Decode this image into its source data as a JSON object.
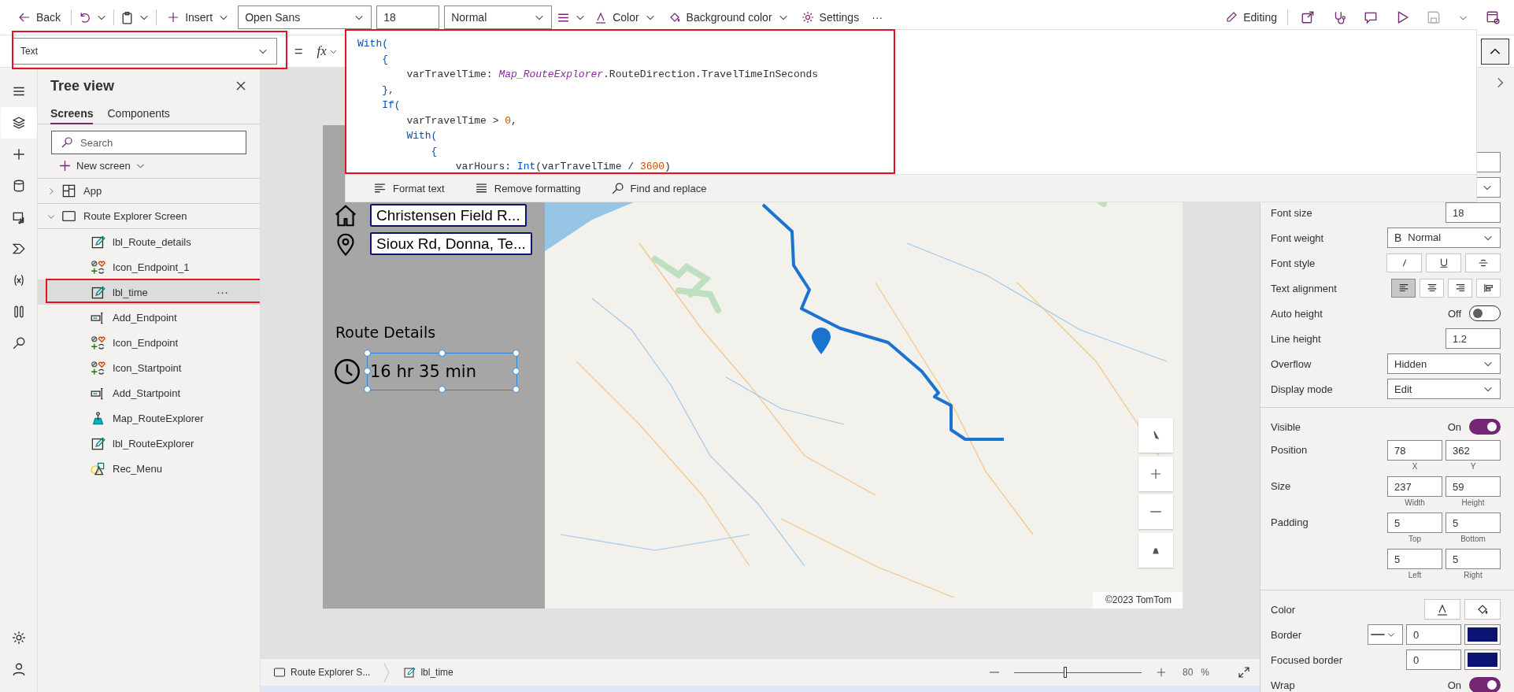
{
  "toolbar": {
    "back": "Back",
    "insert": "Insert",
    "font": "Open Sans",
    "font_size": "18",
    "font_weight": "Normal",
    "text_color_label": "Color",
    "background_color_label": "Background color",
    "settings_label": "Settings",
    "more": "···",
    "mode": "Editing"
  },
  "formula_bar": {
    "property": "Text",
    "equals": "=",
    "fx": "fx",
    "code": [
      [
        {
          "kind": "keyword",
          "text": "With("
        }
      ],
      [
        {
          "kind": "punct",
          "text": "    {"
        }
      ],
      [
        {
          "kind": "plain",
          "text": "        varTravelTime: "
        },
        {
          "kind": "ref",
          "text": "Map_RouteExplorer"
        },
        {
          "kind": "plain",
          "text": ".RouteDirection.TravelTimeInSeconds"
        }
      ],
      [
        {
          "kind": "punct",
          "text": "    },"
        }
      ],
      [
        {
          "kind": "keyword",
          "text": "    If("
        }
      ],
      [
        {
          "kind": "plain",
          "text": "        varTravelTime > "
        },
        {
          "kind": "number",
          "text": "0"
        },
        {
          "kind": "plain",
          "text": ","
        }
      ],
      [
        {
          "kind": "keyword",
          "text": "        With("
        }
      ],
      [
        {
          "kind": "punct",
          "text": "            {"
        }
      ],
      [
        {
          "kind": "plain",
          "text": "                varHours: "
        },
        {
          "kind": "keyword",
          "text": "Int"
        },
        {
          "kind": "plain",
          "text": "(varTravelTime / "
        },
        {
          "kind": "number",
          "text": "3600"
        },
        {
          "kind": "plain",
          "text": ")"
        }
      ]
    ],
    "tools": [
      {
        "kind": "format",
        "label": "Format text"
      },
      {
        "kind": "remove",
        "label": "Remove formatting"
      },
      {
        "kind": "find",
        "label": "Find and replace"
      }
    ]
  },
  "tree": {
    "title": "Tree view",
    "tabs": [
      {
        "label": "Screens",
        "selected": true
      },
      {
        "label": "Components",
        "selected": false
      }
    ],
    "search_placeholder": "Search",
    "new_screen": "New screen",
    "more": "···",
    "items": [
      {
        "label": "App",
        "kind": "app",
        "expanded": false,
        "selected": false
      },
      {
        "label": "Route Explorer Screen",
        "kind": "screen",
        "expanded": true,
        "selected": false,
        "children": [
          {
            "label": "lbl_Route_details",
            "kind": "label",
            "selected": false
          },
          {
            "label": "Icon_Endpoint_1",
            "kind": "icon",
            "selected": false
          },
          {
            "label": "lbl_time",
            "kind": "label",
            "selected": true
          },
          {
            "label": "Add_Endpoint",
            "kind": "input",
            "selected": false
          },
          {
            "label": "Icon_Endpoint",
            "kind": "icon",
            "selected": false
          },
          {
            "label": "Icon_Startpoint",
            "kind": "icon",
            "selected": false
          },
          {
            "label": "Add_Startpoint",
            "kind": "input",
            "selected": false
          },
          {
            "label": "Map_RouteExplorer",
            "kind": "map",
            "selected": false
          },
          {
            "label": "lbl_RouteExplorer",
            "kind": "label",
            "selected": false
          },
          {
            "label": "Rec_Menu",
            "kind": "shape",
            "selected": false
          }
        ]
      }
    ]
  },
  "canvas": {
    "start_address": "Christensen Field R...",
    "end_address": "Sioux Rd, Donna, Te...",
    "route_heading": "Route Details",
    "travel_time": "16 hr 35 min",
    "map_attribution": "©2023 TomTom"
  },
  "properties": [
    {
      "kind": "blank_field"
    },
    {
      "kind": "blank_dropdown"
    },
    {
      "kind": "field",
      "label": "Font size",
      "value": "18"
    },
    {
      "kind": "dropdown",
      "label": "Font weight",
      "prefix": "B",
      "value": "Normal"
    },
    {
      "kind": "style_buttons",
      "label": "Font style",
      "buttons": [
        {
          "kind": "italic"
        },
        {
          "kind": "underline"
        },
        {
          "kind": "strike"
        }
      ]
    },
    {
      "kind": "align_buttons",
      "label": "Text alignment",
      "buttons": [
        {
          "kind": "left",
          "selected": true
        },
        {
          "kind": "center",
          "selected": false
        },
        {
          "kind": "right",
          "selected": false
        },
        {
          "kind": "top",
          "selected": false
        }
      ]
    },
    {
      "kind": "toggle",
      "label": "Auto height",
      "value": "Off",
      "on": false
    },
    {
      "kind": "field",
      "label": "Line height",
      "value": "1.2"
    },
    {
      "kind": "dropdown",
      "label": "Overflow",
      "value": "Hidden"
    },
    {
      "kind": "dropdown",
      "label": "Display mode",
      "value": "Edit"
    },
    {
      "kind": "divider"
    },
    {
      "kind": "toggle",
      "label": "Visible",
      "value": "On",
      "on": true
    },
    {
      "kind": "pair",
      "label": "Position",
      "fields": [
        {
          "value": "78",
          "caption": "X"
        },
        {
          "value": "362",
          "caption": "Y"
        }
      ]
    },
    {
      "kind": "pair",
      "label": "Size",
      "fields": [
        {
          "value": "237",
          "caption": "Width"
        },
        {
          "value": "59",
          "caption": "Height"
        }
      ]
    },
    {
      "kind": "pair",
      "label": "Padding",
      "fields": [
        {
          "value": "5",
          "caption": "Top"
        },
        {
          "value": "5",
          "caption": "Bottom"
        }
      ]
    },
    {
      "kind": "pair",
      "fields": [
        {
          "value": "5",
          "caption": "Left"
        },
        {
          "value": "5",
          "caption": "Right"
        }
      ]
    },
    {
      "kind": "divider"
    },
    {
      "kind": "color_buttons",
      "label": "Color"
    },
    {
      "kind": "border",
      "label": "Border",
      "style_picker": true,
      "value": "0",
      "color": "#0b1470"
    },
    {
      "kind": "border",
      "label": "Focused border",
      "style_picker": false,
      "value": "0",
      "color": "#0b1470"
    },
    {
      "kind": "toggle",
      "label": "Wrap",
      "value": "On",
      "on": true
    }
  ],
  "status_bar": {
    "breadcrumbs": [
      {
        "kind": "screen",
        "label": "Route Explorer S..."
      },
      {
        "kind": "label",
        "label": "lbl_time"
      }
    ],
    "zoom": {
      "level": 0.4,
      "value": "80",
      "unit": "%"
    }
  }
}
